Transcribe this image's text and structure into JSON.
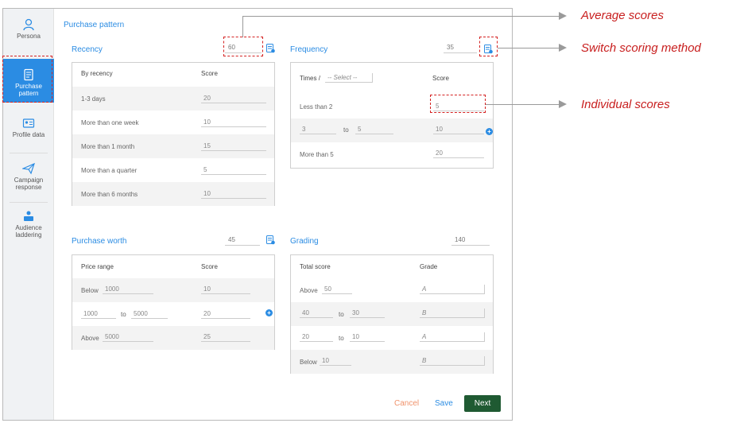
{
  "sidebar": {
    "items": [
      {
        "label": "Persona",
        "icon": "persona-icon"
      },
      {
        "label": "Purchase pattern",
        "icon": "purchase-pattern-icon",
        "active": true
      },
      {
        "label": "Profile data",
        "icon": "profile-data-icon"
      },
      {
        "label": "Campaign response",
        "icon": "campaign-response-icon"
      },
      {
        "label": "Audience laddering",
        "icon": "audience-laddering-icon"
      }
    ]
  },
  "page_title": "Purchase pattern",
  "recency": {
    "title": "Recency",
    "total": "60",
    "col1": "By recency",
    "col2": "Score",
    "rows": [
      {
        "label": "1-3 days",
        "score": "20"
      },
      {
        "label": "More than one week",
        "score": "10"
      },
      {
        "label": "More than 1 month",
        "score": "15"
      },
      {
        "label": "More than a quarter",
        "score": "5"
      },
      {
        "label": "More than 6 months",
        "score": "10"
      }
    ]
  },
  "frequency": {
    "title": "Frequency",
    "total": "35",
    "col1": "Times /",
    "select_placeholder": "-- Select --",
    "col2": "Score",
    "row1": {
      "label": "Less than 2",
      "score": "5"
    },
    "row2": {
      "from": "3",
      "to_label": "to",
      "to": "5",
      "score": "10"
    },
    "row3": {
      "label": "More than 5",
      "score": "20"
    }
  },
  "purchase_worth": {
    "title": "Purchase worth",
    "total": "45",
    "col1": "Price range",
    "col2": "Score",
    "row1": {
      "label": "Below",
      "value": "1000",
      "score": "10"
    },
    "row2": {
      "from": "1000",
      "to_label": "to",
      "to": "5000",
      "score": "20"
    },
    "row3": {
      "label": "Above",
      "value": "5000",
      "score": "25"
    }
  },
  "grading": {
    "title": "Grading",
    "total": "140",
    "col1": "Total score",
    "col2": "Grade",
    "row1": {
      "label": "Above",
      "value": "50",
      "grade": "A"
    },
    "row2": {
      "from": "40",
      "to_label": "to",
      "to": "30",
      "grade": "B"
    },
    "row3": {
      "from": "20",
      "to_label": "to",
      "to": "10",
      "grade": "A"
    },
    "row4": {
      "label": "Below",
      "value": "10",
      "grade": "B"
    }
  },
  "footer": {
    "cancel": "Cancel",
    "save": "Save",
    "next": "Next"
  },
  "callouts": {
    "average": "Average scores",
    "switch": "Switch scoring method",
    "individual": "Individual scores"
  },
  "colors": {
    "accent": "#2b8ce3",
    "next_button": "#1f5a32",
    "annotation": "#c81e1e"
  }
}
